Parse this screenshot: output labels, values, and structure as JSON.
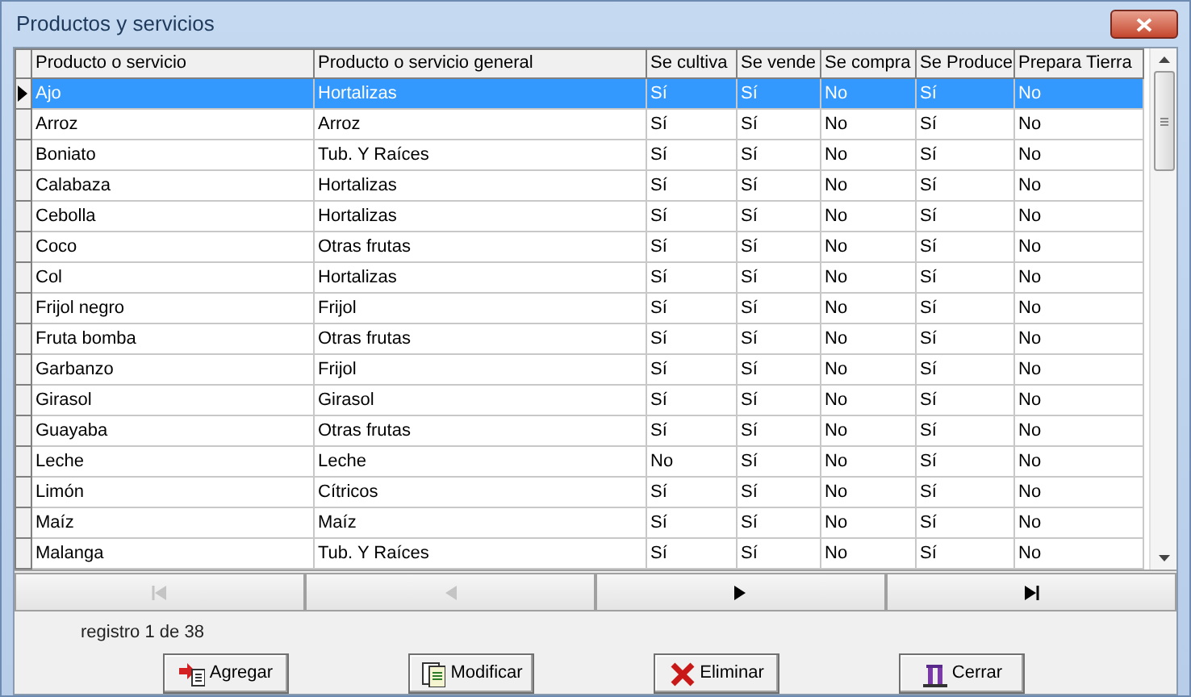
{
  "window": {
    "title": "Productos y servicios"
  },
  "table": {
    "columns": [
      "Producto o servicio",
      "Producto o servicio general",
      "Se cultiva",
      "Se vende",
      "Se compra",
      "Se Produce",
      "Prepara Tierra"
    ],
    "rows": [
      {
        "cells": [
          "Ajo",
          "Hortalizas",
          "Sí",
          "Sí",
          "No",
          "Sí",
          "No"
        ],
        "selected": true
      },
      {
        "cells": [
          "Arroz",
          "Arroz",
          "Sí",
          "Sí",
          "No",
          "Sí",
          "No"
        ],
        "selected": false
      },
      {
        "cells": [
          "Boniato",
          "Tub. Y Raíces",
          "Sí",
          "Sí",
          "No",
          "Sí",
          "No"
        ],
        "selected": false
      },
      {
        "cells": [
          "Calabaza",
          "Hortalizas",
          "Sí",
          "Sí",
          "No",
          "Sí",
          "No"
        ],
        "selected": false
      },
      {
        "cells": [
          "Cebolla",
          "Hortalizas",
          "Sí",
          "Sí",
          "No",
          "Sí",
          "No"
        ],
        "selected": false
      },
      {
        "cells": [
          "Coco",
          "Otras frutas",
          "Sí",
          "Sí",
          "No",
          "Sí",
          "No"
        ],
        "selected": false
      },
      {
        "cells": [
          "Col",
          "Hortalizas",
          "Sí",
          "Sí",
          "No",
          "Sí",
          "No"
        ],
        "selected": false
      },
      {
        "cells": [
          "Frijol negro",
          "Frijol",
          "Sí",
          "Sí",
          "No",
          "Sí",
          "No"
        ],
        "selected": false
      },
      {
        "cells": [
          "Fruta bomba",
          "Otras frutas",
          "Sí",
          "Sí",
          "No",
          "Sí",
          "No"
        ],
        "selected": false
      },
      {
        "cells": [
          "Garbanzo",
          "Frijol",
          "Sí",
          "Sí",
          "No",
          "Sí",
          "No"
        ],
        "selected": false
      },
      {
        "cells": [
          "Girasol",
          "Girasol",
          "Sí",
          "Sí",
          "No",
          "Sí",
          "No"
        ],
        "selected": false
      },
      {
        "cells": [
          "Guayaba",
          "Otras frutas",
          "Sí",
          "Sí",
          "No",
          "Sí",
          "No"
        ],
        "selected": false
      },
      {
        "cells": [
          "Leche",
          "Leche",
          "No",
          "Sí",
          "No",
          "Sí",
          "No"
        ],
        "selected": false
      },
      {
        "cells": [
          "Limón",
          "Cítricos",
          "Sí",
          "Sí",
          "No",
          "Sí",
          "No"
        ],
        "selected": false
      },
      {
        "cells": [
          "Maíz",
          "Maíz",
          "Sí",
          "Sí",
          "No",
          "Sí",
          "No"
        ],
        "selected": false
      },
      {
        "cells": [
          "Malanga",
          "Tub. Y Raíces",
          "Sí",
          "Sí",
          "No",
          "Sí",
          "No"
        ],
        "selected": false
      }
    ]
  },
  "navigation": [
    {
      "kind": "first",
      "disabled": true
    },
    {
      "kind": "previous",
      "disabled": true
    },
    {
      "kind": "next",
      "disabled": false
    },
    {
      "kind": "last",
      "disabled": false
    }
  ],
  "record_label": "registro 1 de 38",
  "buttons": [
    {
      "kind": "add",
      "label": "Agregar"
    },
    {
      "kind": "edit",
      "label": "Modificar"
    },
    {
      "kind": "delete",
      "label": "Eliminar"
    },
    {
      "kind": "close",
      "label": "Cerrar"
    }
  ]
}
